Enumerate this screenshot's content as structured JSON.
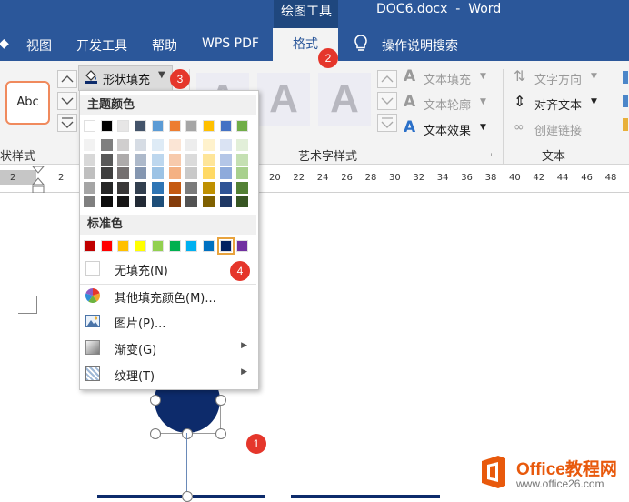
{
  "title_bar": {
    "drawing_tools": "绘图工具",
    "document": "DOC6.docx  -  Word"
  },
  "tabs": [
    {
      "label": "视图"
    },
    {
      "label": "开发工具"
    },
    {
      "label": "帮助"
    },
    {
      "label": "WPS PDF"
    },
    {
      "label": "格式",
      "active": true
    }
  ],
  "tell_me": "操作说明搜索",
  "ribbon": {
    "shape_style_sample": "Abc",
    "shape_styles_group": "状样式",
    "shape_fill_label": "形状填充",
    "wordart_sample": "A",
    "wordart_group": "艺术字样式",
    "text_fill": "文本填充",
    "text_outline": "文本轮廓",
    "text_effects": "文本效果",
    "text_direction": "文字方向",
    "align_text": "对齐文本",
    "create_link": "创建链接",
    "text_group": "文本"
  },
  "ruler": {
    "left_numbers": [
      "2",
      "2"
    ],
    "numbers": [
      "20",
      "22",
      "24",
      "26",
      "28",
      "30",
      "32",
      "34",
      "36",
      "38",
      "40",
      "42",
      "44",
      "46",
      "48"
    ]
  },
  "dropdown": {
    "theme_colors_label": "主题颜色",
    "theme_colors": [
      "#ffffff",
      "#000000",
      "#e7e6e6",
      "#44546a",
      "#5b9bd5",
      "#ed7d31",
      "#a5a5a5",
      "#ffc000",
      "#4472c4",
      "#70ad47"
    ],
    "theme_shades": [
      [
        "#f2f2f2",
        "#7f7f7f",
        "#d0cece",
        "#d6dce4",
        "#deebf6",
        "#fbe5d5",
        "#ededed",
        "#fff2cc",
        "#dae3f3",
        "#e2efd9"
      ],
      [
        "#d8d8d8",
        "#595959",
        "#aeabab",
        "#adb9ca",
        "#bdd7ee",
        "#f7caac",
        "#dbdbdb",
        "#fee599",
        "#b4c6e7",
        "#c5e0b3"
      ],
      [
        "#bfbfbf",
        "#3f3f3f",
        "#757070",
        "#8496b0",
        "#9cc3e5",
        "#f4b183",
        "#c9c9c9",
        "#ffd965",
        "#8eaadb",
        "#a8d08d"
      ],
      [
        "#a5a5a5",
        "#262626",
        "#3a3838",
        "#323f4f",
        "#2e75b5",
        "#c55a11",
        "#7b7b7b",
        "#bf9000",
        "#2f5496",
        "#538135"
      ],
      [
        "#7f7f7f",
        "#0c0c0c",
        "#171616",
        "#222a35",
        "#1e4e79",
        "#843c0b",
        "#525252",
        "#7f6000",
        "#1f3864",
        "#375623"
      ]
    ],
    "standard_colors_label": "标准色",
    "standard_colors": [
      "#c00000",
      "#ff0000",
      "#ffc000",
      "#ffff00",
      "#92d050",
      "#00b050",
      "#00b0f0",
      "#0070c0",
      "#002060",
      "#7030a0"
    ],
    "selected_standard_index": 8,
    "items": [
      {
        "label": "无填充(N)",
        "icon": "no-fill-swatch-icon"
      },
      {
        "label": "其他填充颜色(M)...",
        "icon": "color-wheel-icon"
      },
      {
        "label": "图片(P)...",
        "icon": "picture-icon"
      },
      {
        "label": "渐变(G)",
        "icon": "gradient-icon",
        "submenu": true
      },
      {
        "label": "纹理(T)",
        "icon": "texture-icon",
        "submenu": true
      }
    ]
  },
  "callouts": [
    "1",
    "2",
    "3",
    "4"
  ],
  "shape_fill_color": "#0d2b6b",
  "watermark": {
    "title": "Office教程网",
    "url": "www.office26.com"
  }
}
